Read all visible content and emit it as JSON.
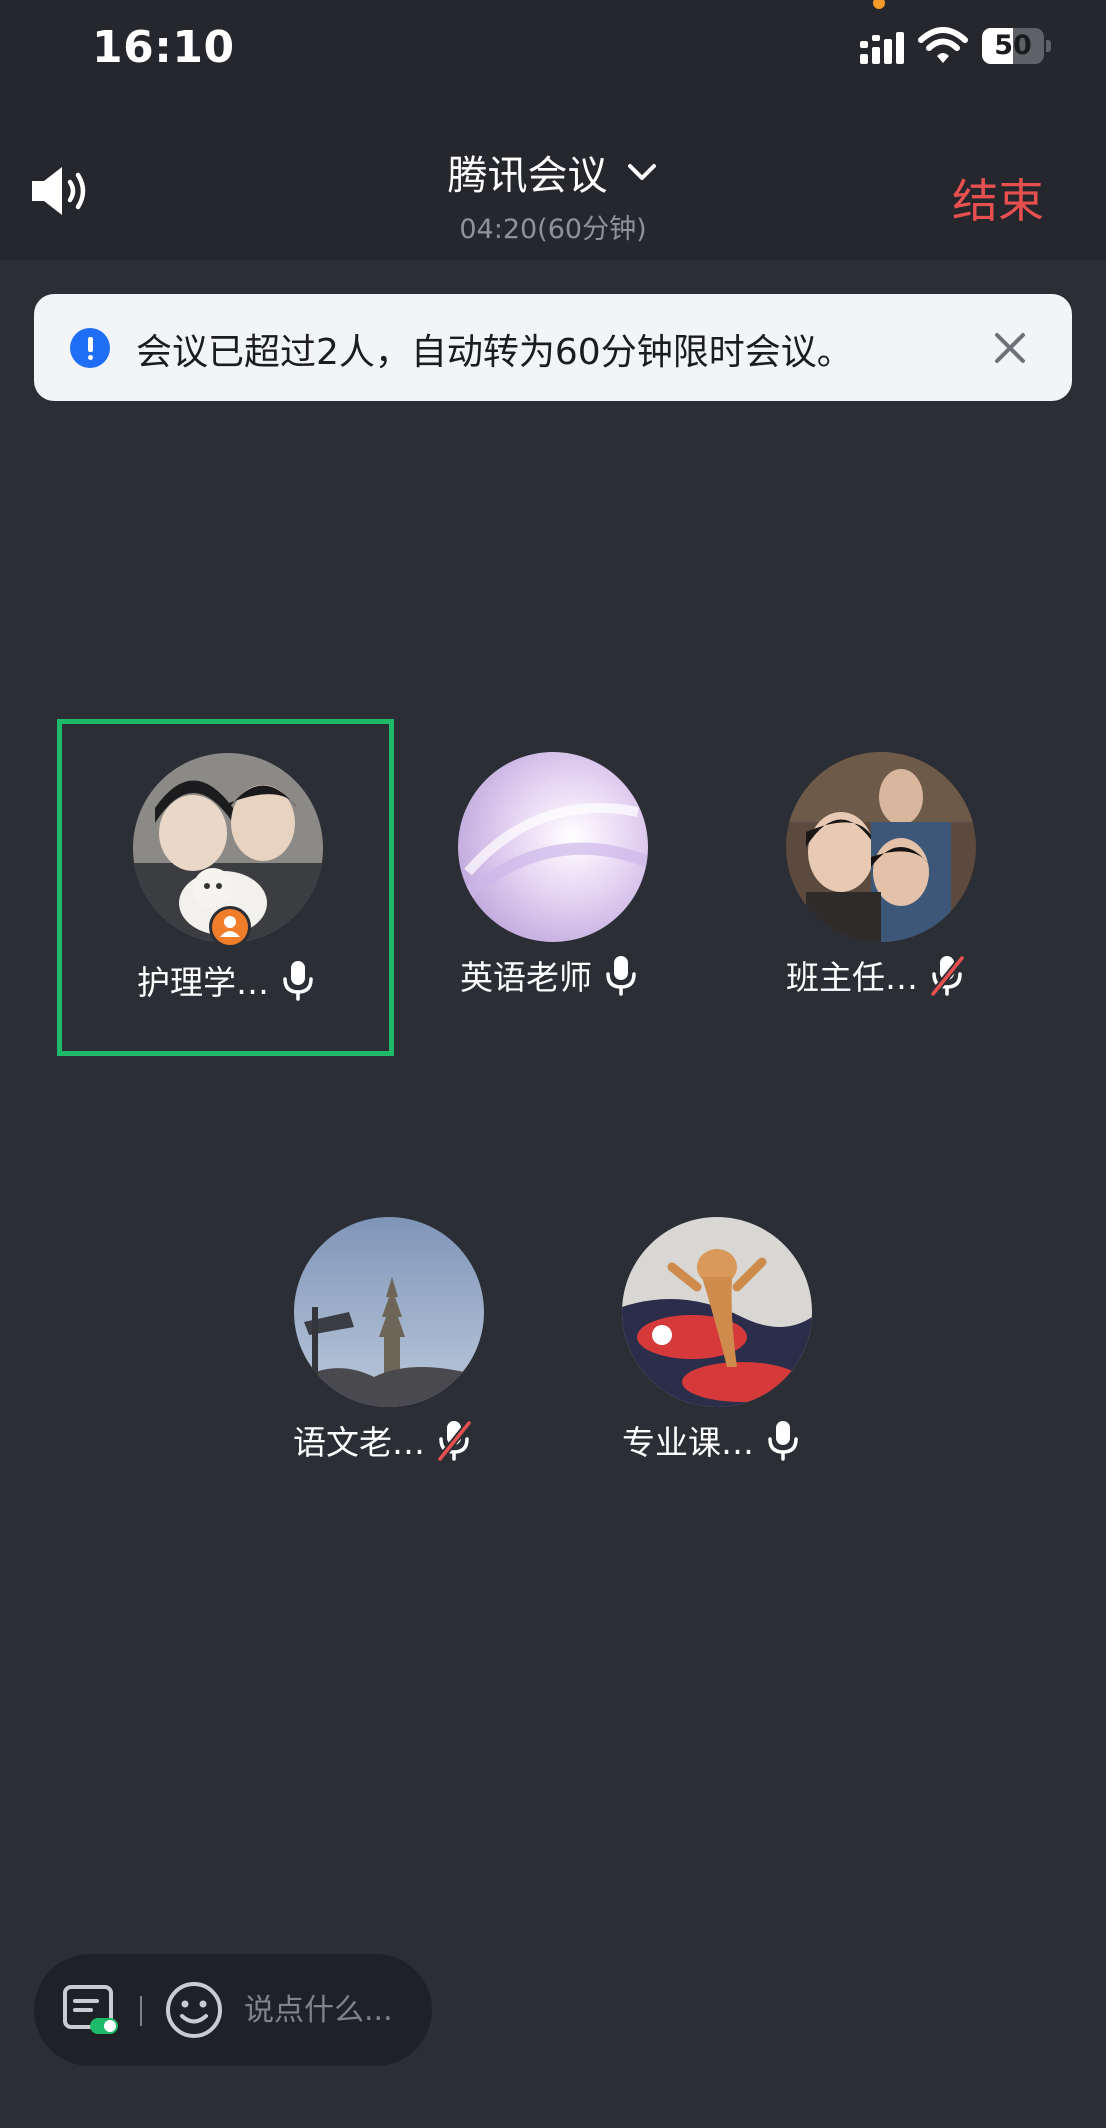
{
  "status_bar": {
    "time": "16:10",
    "battery_level": "50",
    "battery_fraction": 0.5
  },
  "header": {
    "speaker_icon": "speaker-icon",
    "title": "腾讯会议",
    "title_icon": "chevron-down-icon",
    "timer": "04:20(60分钟)",
    "end_label": "结束",
    "end_color": "#e84f4f"
  },
  "notice": {
    "icon": "info-icon",
    "text": "会议已超过2人，自动转为60分钟限时会议。",
    "close_icon": "close-icon",
    "accent_color": "#1f6ef5"
  },
  "participants": [
    {
      "name": "护理学…",
      "mic": "on",
      "host": true,
      "speaking": true
    },
    {
      "name": "英语老师",
      "mic": "on",
      "host": false,
      "speaking": false
    },
    {
      "name": "班主任…",
      "mic": "muted",
      "host": false,
      "speaking": false
    },
    {
      "name": "语文老…",
      "mic": "muted",
      "host": false,
      "speaking": false
    },
    {
      "name": "专业课…",
      "mic": "on",
      "host": false,
      "speaking": false
    }
  ],
  "chat_bar": {
    "list_icon": "chat-list-icon",
    "emoji_icon": "emoji-icon",
    "placeholder": "说点什么..."
  },
  "colors": {
    "active_border": "#1fb96a",
    "muted_slash": "#e84f4f",
    "host_badge": "#f07d2a"
  }
}
